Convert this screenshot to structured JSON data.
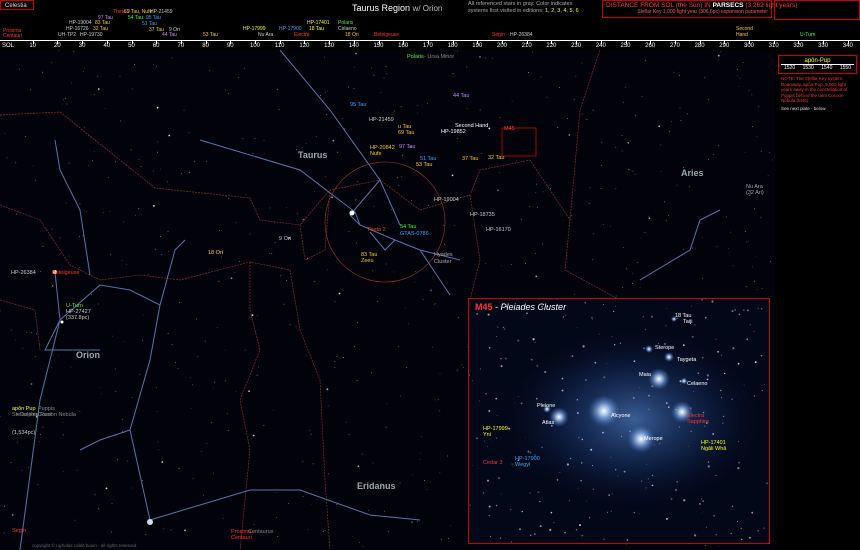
{
  "app": {
    "button": "Celestia"
  },
  "header": {
    "title": "Taurus Region",
    "subtitle": "w/ Orion",
    "note_line1": "All referenced stars in gray. Color indicates",
    "note_line2": "systems first visited in editions",
    "note_editions": "1, 2, 3, 4, 5, 6",
    "distance_title_pre": "DISTANCE FROM SOL (the Sun) IN",
    "distance_title_unit": "PARSECS",
    "distance_title_post": "(3.262 light years)",
    "distance_sub": "Stellar Key 1,000 light year (306.6pc) expansion parameter"
  },
  "scale": {
    "start_label": "SOL",
    "ticks": [
      "10",
      "20",
      "30",
      "40",
      "50",
      "60",
      "70",
      "80",
      "90",
      "100",
      "110",
      "120",
      "130",
      "140",
      "150",
      "160",
      "170",
      "180",
      "190",
      "200",
      "210",
      "220",
      "230",
      "240",
      "250",
      "260",
      "270",
      "280",
      "290",
      "300",
      "310",
      "320",
      "330",
      "340"
    ]
  },
  "scale_stars": [
    {
      "text": "Proxima",
      "color": "#ff3333"
    },
    {
      "text": "Centauri",
      "color": "#ff3333"
    },
    {
      "text": "HP-19004",
      "color": "#cccccc"
    },
    {
      "text": "HP-16726",
      "color": "#cccccc"
    },
    {
      "text": "32 Tau",
      "color": "#ffcc00"
    },
    {
      "text": "UH-TP2",
      "color": "#cccccc"
    },
    {
      "text": "HP-19730",
      "color": "#cccccc"
    },
    {
      "text": "Theta 2",
      "color": "#ff3333"
    },
    {
      "text": "97 Tau",
      "color": "#cc88ff"
    },
    {
      "text": "83 Tau",
      "color": "#ffcc00"
    },
    {
      "text": "69 Tau, Nufe",
      "color": "#ffcc00"
    },
    {
      "text": "HP-21459",
      "color": "#cccccc"
    },
    {
      "text": "54 Tau",
      "color": "#33ff33"
    },
    {
      "text": "95 Tau",
      "color": "#33aaff"
    },
    {
      "text": "51 Tau",
      "color": "#33aaff"
    },
    {
      "text": "37 Tau",
      "color": "#ffcc00"
    },
    {
      "text": "9 Ori",
      "color": "#cccccc"
    },
    {
      "text": "44 Tau",
      "color": "#cc88ff"
    },
    {
      "text": "53 Tau",
      "color": "#ffcc00"
    },
    {
      "text": "HP-17999",
      "color": "#ffff00"
    },
    {
      "text": "Nu Ara",
      "color": "#cccccc"
    },
    {
      "text": "HP-17900",
      "color": "#33aaff"
    },
    {
      "text": "Electra",
      "color": "#ff3333"
    },
    {
      "text": "HP-17401",
      "color": "#ffff00"
    },
    {
      "text": "18 Tau",
      "color": "#ffff00"
    },
    {
      "text": "Polaris",
      "color": "#33ff33"
    },
    {
      "text": "Celaeno",
      "color": "#cccccc"
    },
    {
      "text": "18 Ori",
      "color": "#ffcc00"
    },
    {
      "text": "Betelgeuse",
      "color": "#ff3333"
    },
    {
      "text": "Segin",
      "color": "#ff3333"
    },
    {
      "text": "HP-26384",
      "color": "#cccccc"
    },
    {
      "text": "Second",
      "color": "#ffcc00"
    },
    {
      "text": "Hand",
      "color": "#ffcc00"
    },
    {
      "text": "U-Turn",
      "color": "#33ff33"
    }
  ],
  "constellations": {
    "taurus": "Taurus",
    "aries": "Aries",
    "orion": "Orion",
    "eridanus": "Eridanus"
  },
  "map_labels": [
    {
      "text": "Polaris",
      "color": "#33ff33"
    },
    {
      "text": "- Ursa Minor",
      "color": "#888888"
    },
    {
      "text": "95 Tau",
      "color": "#33aaff"
    },
    {
      "text": "44 Tau",
      "color": "#cc88ff"
    },
    {
      "text": "HP-21459",
      "color": "#cccccc"
    },
    {
      "text": "u Tau",
      "color": "#ffcc00"
    },
    {
      "text": "69 Tau",
      "color": "#ffcc00"
    },
    {
      "text": "Second Hand",
      "color": "#ffffff"
    },
    {
      "text": "HP-19852",
      "color": "#ffffff"
    },
    {
      "text": "M45",
      "color": "#ff3333"
    },
    {
      "text": "HP-20842",
      "color": "#ffcc00"
    },
    {
      "text": "Nufe",
      "color": "#ffcc00"
    },
    {
      "text": "97 Tau",
      "color": "#cc88ff"
    },
    {
      "text": "51 Tau",
      "color": "#33aaff"
    },
    {
      "text": "53 Tau",
      "color": "#ffcc00"
    },
    {
      "text": "37 Tau",
      "color": "#ffcc00"
    },
    {
      "text": "32 Tau",
      "color": "#ffcc00"
    },
    {
      "text": "HP-19004",
      "color": "#cccccc"
    },
    {
      "text": "Theta 2",
      "color": "#ff3333"
    },
    {
      "text": "54 Tau",
      "color": "#33ff33"
    },
    {
      "text": "GTAS-0786",
      "color": "#33aaff"
    },
    {
      "text": "HP-18735",
      "color": "#cccccc"
    },
    {
      "text": "HP-16170",
      "color": "#cccccc"
    },
    {
      "text": "9 Ori",
      "color": "#cccccc"
    },
    {
      "text": "18 Ori",
      "color": "#ffcc00"
    },
    {
      "text": "83 Tau",
      "color": "#ffcc00"
    },
    {
      "text": "Zeeu",
      "color": "#ffcc00"
    },
    {
      "text": "Hyades",
      "color": "#aaaaaa"
    },
    {
      "text": "Cluster",
      "color": "#aaaaaa"
    },
    {
      "text": "Nu Ara",
      "color": "#aaaaaa"
    },
    {
      "text": "(32 Ari)",
      "color": "#aaaaaa"
    },
    {
      "text": "HP-26384",
      "color": "#cccccc"
    },
    {
      "text": "Betelgeuse",
      "color": "#ff3333"
    },
    {
      "text": "U-Turn",
      "color": "#33ff33"
    },
    {
      "text": "HP-27427",
      "color": "#cccccc"
    },
    {
      "text": "(337.8pc)",
      "color": "#cccccc"
    },
    {
      "text": "apôn Pup",
      "color": "#ffff00"
    },
    {
      "text": "Puppis",
      "color": "#888888"
    },
    {
      "text": "Cocoon Nebula",
      "color": "#888888"
    },
    {
      "text": "Stellar Key",
      "color": "#888888"
    },
    {
      "text": "Dolphin Reef",
      "color": "#888888"
    },
    {
      "text": "(1,534pc)",
      "color": "#cccccc"
    },
    {
      "text": "Segin",
      "color": "#ff3333"
    },
    {
      "text": "Proxima",
      "color": "#ff3333"
    },
    {
      "text": "Centauri",
      "color": "#ff3333"
    },
    {
      "text": "Centaurus",
      "color": "#888888"
    }
  ],
  "inset": {
    "m": "M45",
    "name": "Pleiades Cluster",
    "labels": [
      {
        "text": "18 Tau",
        "color": "#ffffff"
      },
      {
        "text": "Taiji",
        "color": "#ffffff"
      },
      {
        "text": "Sterope",
        "color": "#ffffff"
      },
      {
        "text": "Taygeta",
        "color": "#ffffff"
      },
      {
        "text": "Maia",
        "color": "#ffffff"
      },
      {
        "text": "Celaeno",
        "color": "#ffffff"
      },
      {
        "text": "Pleione",
        "color": "#ffffff"
      },
      {
        "text": "Alcyone",
        "color": "#ffffff"
      },
      {
        "text": "Atlas",
        "color": "#ffffff"
      },
      {
        "text": "Electra",
        "color": "#ff3333"
      },
      {
        "text": "Sapphire",
        "color": "#ff3333"
      },
      {
        "text": "Merope",
        "color": "#ffffff"
      },
      {
        "text": "HP-17999",
        "color": "#ffff00"
      },
      {
        "text": "Yni",
        "color": "#ffff00"
      },
      {
        "text": "HP-17401",
        "color": "#ffff00"
      },
      {
        "text": "Ngâli Whâ",
        "color": "#ffff00"
      },
      {
        "text": "Cedar 3",
        "color": "#ff3333"
      },
      {
        "text": "HP-17900",
        "color": "#33aaff"
      },
      {
        "text": "Wegyl",
        "color": "#33aaff"
      }
    ]
  },
  "side_panel": {
    "title": "apôn-Pup",
    "years": [
      "1520",
      "1530",
      "1540",
      "1550"
    ],
    "note": "NOTE: The Stellar Key system, Roamway, apôn-Pup, 5,000 light years away in the constellation of Puppis behind the faint Cocoon Nebula (M46)",
    "next": "See next plate - below"
  },
  "copyright": "copyright © nicholas caleb bouin - all rights reserved"
}
